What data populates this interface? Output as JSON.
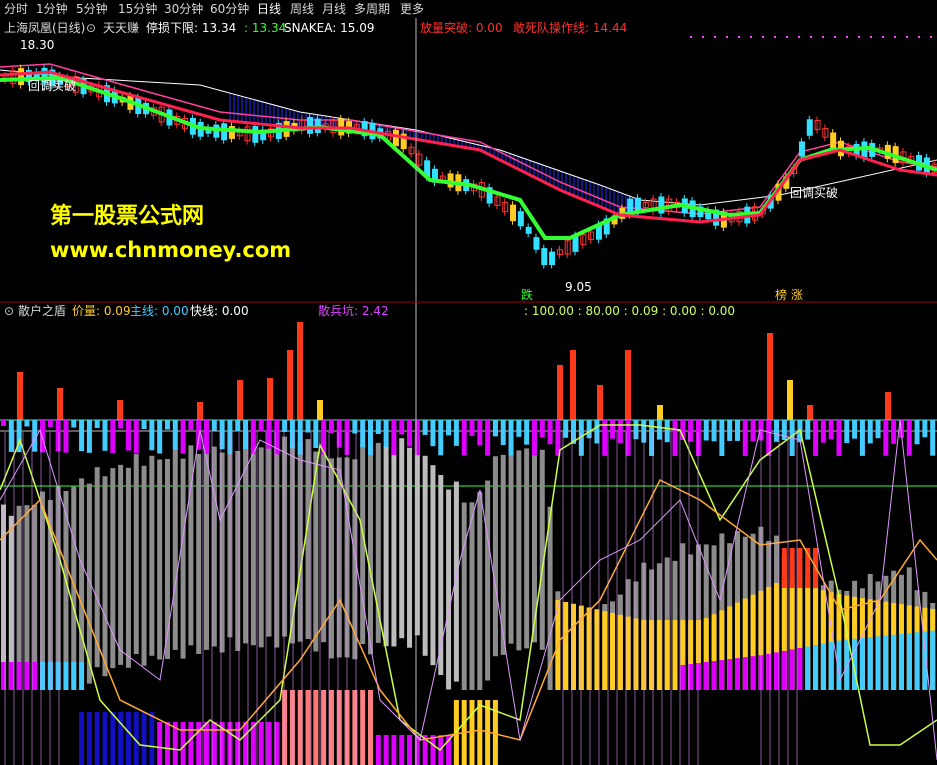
{
  "menu": {
    "items": [
      "分时",
      "1分钟",
      "5分钟",
      "15分钟",
      "30分钟",
      "60分钟",
      "日线",
      "周线",
      "月线",
      "多周期",
      "更多"
    ],
    "active_index": 6
  },
  "main_panel": {
    "stock_name": "上海凤凰(日线)",
    "indicator_name": "天天赚",
    "stop_loss_label": "停损下限: 13.34",
    "value_1": ": 13.34",
    "snakea_label": "SNAKEA: 15.09",
    "breakout_label": "放量突破: 0.00",
    "dare_label": "敢死队操作线: 14.44",
    "high_price": "18.30",
    "low_price": "9.05",
    "pullback_label": "回调买破",
    "pullback_label_2": "回调买破",
    "fall_label": "跌",
    "rise_label": "榜 涨",
    "watermark_title": "第一股票公式网",
    "watermark_url": "www.chnmoney.com",
    "colors": {
      "up": "#ff3333",
      "down": "#33e0ff",
      "ma_green": "#33ff33",
      "ma_red": "#ff2050",
      "ma_pink": "#ff40a0",
      "band": "#2030ff"
    }
  },
  "sub_panel": {
    "indicator_name": "散户之盾",
    "price_label": "价量: 0.09",
    "main_line_label": "主线: 0.00",
    "fast_line_label": "快线: 0.00",
    "retail_label": "散兵坑: 2.42",
    "values_label": ": 100.00 : 80.00 : 0.09 : 0.00 : 0.00",
    "colors": {
      "gray": "#8c8c8c",
      "yellow": "#ffcc22",
      "magenta": "#dd00ff",
      "cyan": "#44ccff",
      "blue": "#1010c0",
      "red": "#ff3a1a"
    }
  }
}
